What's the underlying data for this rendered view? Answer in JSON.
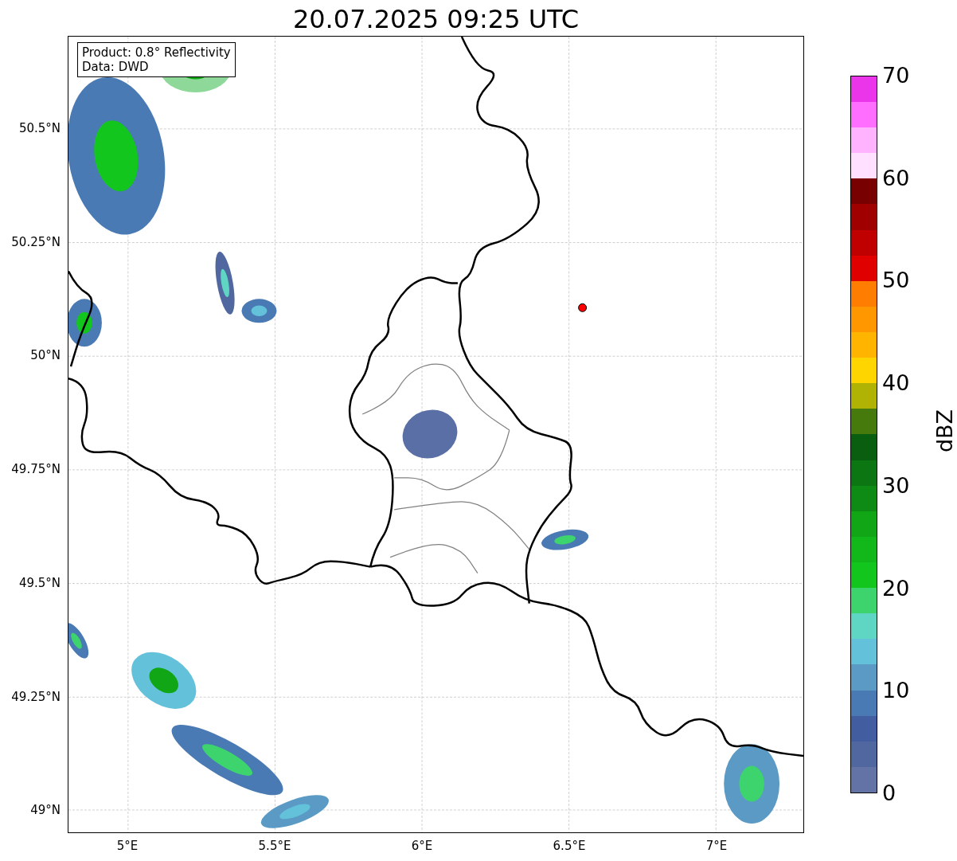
{
  "title": "20.07.2025 09:25 UTC",
  "map": {
    "info_box": [
      "Product: 0.8° Reflectivity",
      "Data: DWD"
    ],
    "y_ticks": [
      "50.5°N",
      "50.25°N",
      "50°N",
      "49.75°N",
      "49.5°N",
      "49.25°N",
      "49°N"
    ],
    "x_ticks": [
      "5°E",
      "5.5°E",
      "6°E",
      "6.5°E",
      "7°E"
    ]
  },
  "colorbar": {
    "label": "dBZ",
    "ticks": [
      "70",
      "60",
      "50",
      "40",
      "30",
      "20",
      "10",
      "0"
    ],
    "segments": [
      {
        "color": "#6473a6"
      },
      {
        "color": "#50679f"
      },
      {
        "color": "#425ea0"
      },
      {
        "color": "#4a7ab3"
      },
      {
        "color": "#5a9ac4"
      },
      {
        "color": "#63c2da"
      },
      {
        "color": "#5fd6c4"
      },
      {
        "color": "#3dd46e"
      },
      {
        "color": "#13c61d"
      },
      {
        "color": "#12b81a"
      },
      {
        "color": "#10a616"
      },
      {
        "color": "#0d8b14"
      },
      {
        "color": "#0b7612"
      },
      {
        "color": "#0a5e0f"
      },
      {
        "color": "#467a0c"
      },
      {
        "color": "#b0b204"
      },
      {
        "color": "#ffd500"
      },
      {
        "color": "#ffb400"
      },
      {
        "color": "#ff9800"
      },
      {
        "color": "#ff7d00"
      },
      {
        "color": "#e00000"
      },
      {
        "color": "#c00000"
      },
      {
        "color": "#a00000"
      },
      {
        "color": "#780000"
      },
      {
        "color": "#ffe0ff"
      },
      {
        "color": "#ffb3ff"
      },
      {
        "color": "#ff6eff"
      },
      {
        "color": "#ea35ea"
      }
    ]
  }
}
